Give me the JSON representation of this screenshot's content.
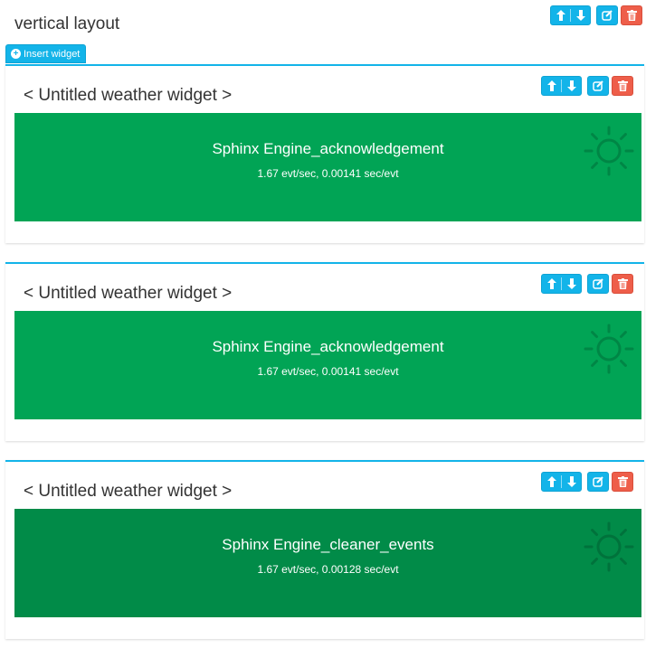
{
  "layout": {
    "title": "vertical layout",
    "insert_label": "Insert widget"
  },
  "colors": {
    "accent": "#13b4e9",
    "danger": "#ee5e4a",
    "status_ok": "#01a455",
    "status_ok_dark": "#018b48"
  },
  "icons": {
    "move": [
      "arrow-up-icon",
      "arrow-down-icon"
    ],
    "edit": "edit-icon",
    "delete": "trash-icon",
    "weather": "sun-icon"
  },
  "widgets": [
    {
      "title": "< Untitled weather widget >",
      "name": "Sphinx Engine_acknowledgement",
      "stats": "1.67 evt/sec, 0.00141 sec/evt",
      "color": "#01a455"
    },
    {
      "title": "< Untitled weather widget >",
      "name": "Sphinx Engine_acknowledgement",
      "stats": "1.67 evt/sec, 0.00141 sec/evt",
      "color": "#01a455"
    },
    {
      "title": "< Untitled weather widget >",
      "name": "Sphinx Engine_cleaner_events",
      "stats": "1.67 evt/sec, 0.00128 sec/evt",
      "color": "#018b48"
    }
  ]
}
